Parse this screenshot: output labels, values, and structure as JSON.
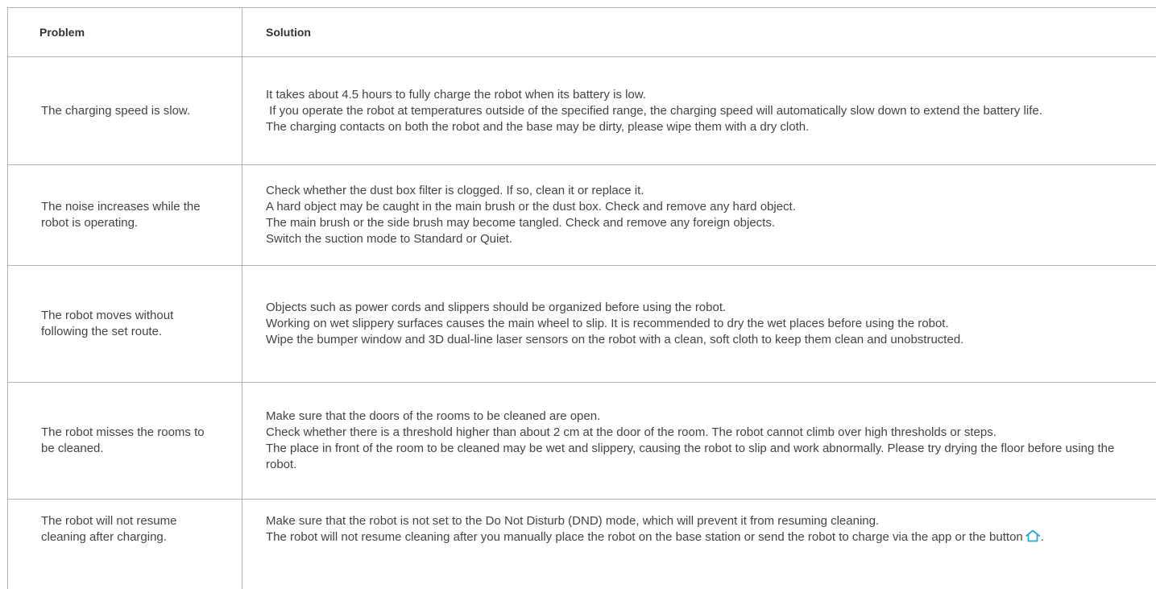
{
  "table": {
    "headers": {
      "problem": "Problem",
      "solution": "Solution"
    },
    "rows": [
      {
        "problem": "The charging speed is slow.",
        "solution": [
          "It takes about 4.5 hours to fully charge the robot when its battery is low.",
          " If you operate the robot at temperatures outside of the specified range, the charging speed will automatically slow down to extend the battery life.",
          "The charging contacts on both the robot and the base may be dirty, please wipe them with a dry cloth."
        ]
      },
      {
        "problem": "The noise increases while the robot is operating.",
        "solution": [
          "Check whether the dust box filter is clogged. If so, clean it or replace it.",
          "A hard object may be caught in the main brush or the dust box. Check and remove any hard object.",
          "The main brush or the side brush may become tangled. Check and remove any foreign objects.",
          "Switch the suction mode to Standard or Quiet."
        ]
      },
      {
        "problem": "The robot moves without following the set route.",
        "solution": [
          "Objects such as power cords and slippers should be organized before using the robot.",
          "Working on wet slippery surfaces causes the main wheel to slip. It is recommended to dry the wet places before using the robot.",
          "Wipe the bumper window and 3D dual-line laser sensors on the robot with a clean, soft cloth to keep them clean and unobstructed."
        ]
      },
      {
        "problem": "The robot misses the rooms to be cleaned.",
        "solution": [
          "Make sure that the doors of the rooms to be cleaned are open.",
          "Check whether there is a threshold higher than about 2 cm at the door of the room. The robot cannot climb over high thresholds or steps.",
          "The place in front of the room to be cleaned may be wet and slippery, causing the robot to slip and work abnormally. Please try drying the floor before using the robot."
        ]
      },
      {
        "problem": "The robot will not resume cleaning after charging.",
        "solution": [
          "Make sure that the robot is not set to the Do Not Disturb (DND) mode, which will prevent it from resuming cleaning.",
          "The robot will not resume cleaning after you manually place the robot on the base station or send the robot to charge via the app or the button",
          "."
        ]
      }
    ]
  },
  "icons": {
    "home_icon": "home-icon",
    "home_icon_color": "#29a8d8"
  },
  "colors": {
    "border": "#b3b3b3",
    "text": "#444444",
    "header_text": "#333333"
  }
}
